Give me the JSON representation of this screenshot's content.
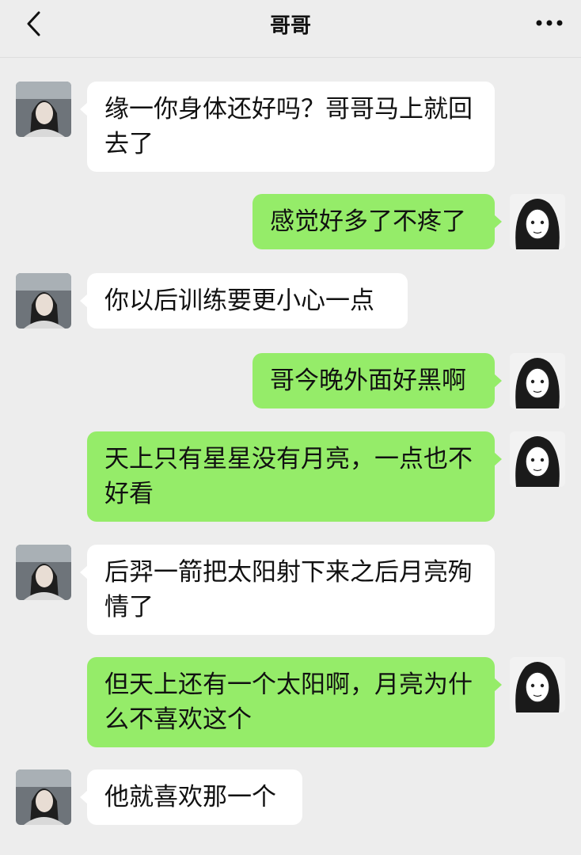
{
  "header": {
    "title": "哥哥",
    "back_icon": "chevron-left-icon",
    "more_icon": "more-horizontal-icon"
  },
  "colors": {
    "background": "#ededed",
    "incoming_bubble": "#ffffff",
    "outgoing_bubble": "#95ec69"
  },
  "messages": [
    {
      "from": "brother",
      "text": "缘一你身体还好吗？哥哥马上就回去了"
    },
    {
      "from": "me",
      "text": "感觉好多了不疼了"
    },
    {
      "from": "brother",
      "text": "你以后训练要更小心一点"
    },
    {
      "from": "me",
      "text": "哥今晚外面好黑啊"
    },
    {
      "from": "me",
      "text": "天上只有星星没有月亮，一点也不好看"
    },
    {
      "from": "brother",
      "text": "后羿一箭把太阳射下来之后月亮殉情了"
    },
    {
      "from": "me",
      "text": "但天上还有一个太阳啊，月亮为什么不喜欢这个"
    },
    {
      "from": "brother",
      "text": "他就喜欢那一个"
    }
  ]
}
